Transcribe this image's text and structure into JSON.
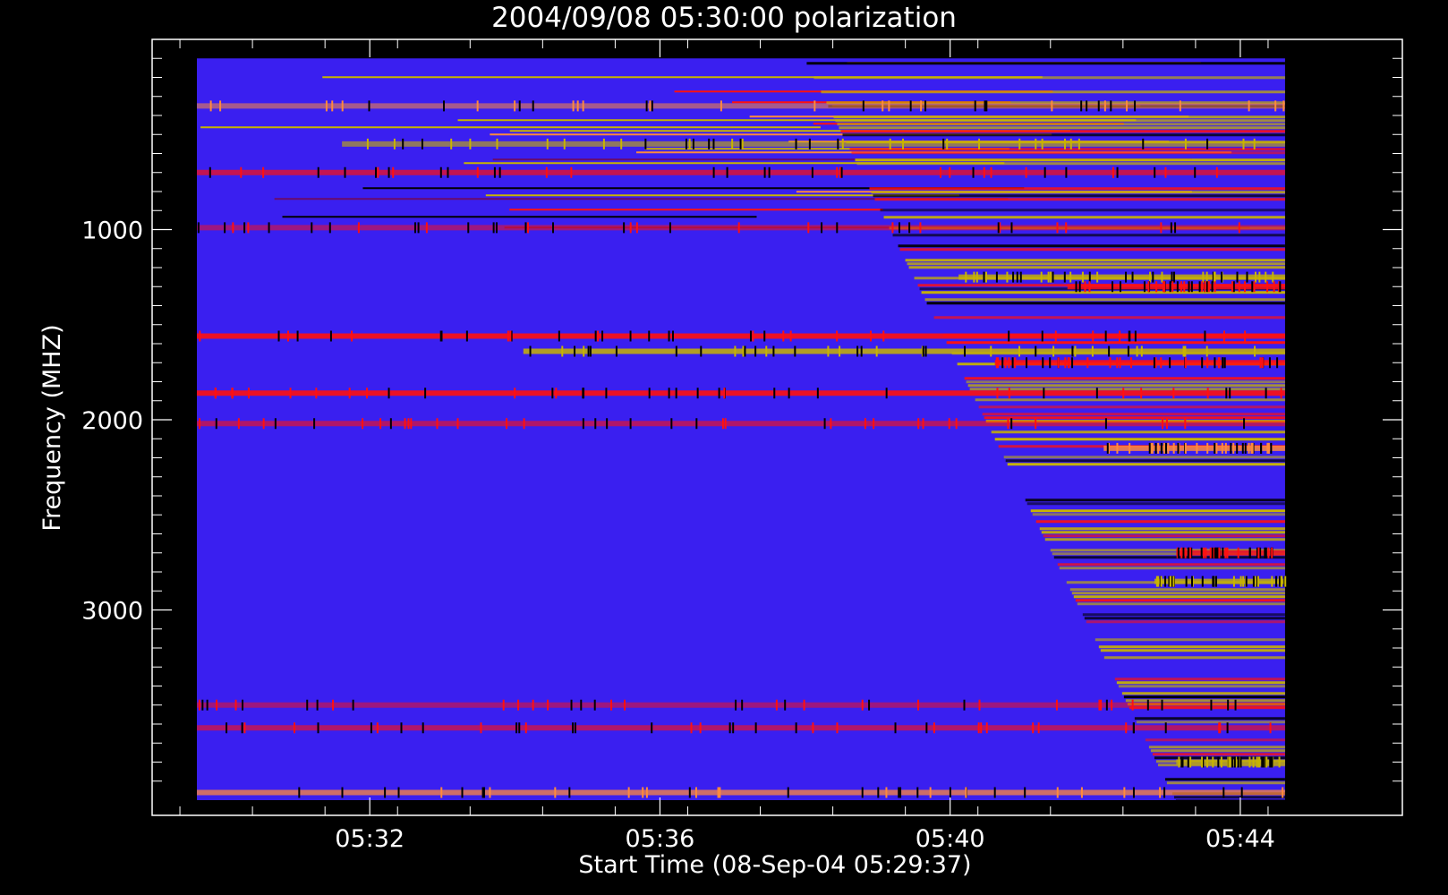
{
  "chart_data": {
    "type": "heatmap",
    "title": "2004/09/08 05:30:00 polarization",
    "xlabel": "Start Time (08-Sep-04 05:29:37)",
    "ylabel": "Frequency (MHZ)",
    "x_ticks": [
      "05:32",
      "05:36",
      "05:40",
      "05:44"
    ],
    "x_tick_minutes": [
      2.383,
      6.383,
      10.383,
      14.383
    ],
    "x_range_minutes": [
      -0.617,
      16.617
    ],
    "x_data_range_minutes": [
      0.0,
      15.0
    ],
    "y_ticks": [
      "1000",
      "2000",
      "3000"
    ],
    "y_tick_values": [
      1000,
      2000,
      3000
    ],
    "y_range": [
      0,
      4080
    ],
    "y_data_range": [
      100,
      4000
    ],
    "y_inverted": true,
    "colormap": {
      "background": "#3a1ff0",
      "levels": [
        "#000000",
        "#6a0a6a",
        "#ff1010",
        "#ff8a3c",
        "#c8b400",
        "#ffff80"
      ]
    },
    "bands": [
      {
        "freq": 350,
        "onset_min": 0,
        "strength": 0.55,
        "color": "#ff8a3c"
      },
      {
        "freq": 550,
        "onset_min": 2,
        "strength": 0.6,
        "color": "#c8b400"
      },
      {
        "freq": 700,
        "onset_min": 0,
        "strength": 0.7,
        "color": "#ff1010"
      },
      {
        "freq": 990,
        "onset_min": 0,
        "strength": 0.5,
        "color": "#ff1010"
      },
      {
        "freq": 1250,
        "onset_min": 10.5,
        "strength": 0.8,
        "color": "#c8b400"
      },
      {
        "freq": 1300,
        "onset_min": 12,
        "strength": 0.85,
        "color": "#ff1010"
      },
      {
        "freq": 1560,
        "onset_min": 0,
        "strength": 0.9,
        "color": "#ff1010"
      },
      {
        "freq": 1640,
        "onset_min": 4.5,
        "strength": 0.85,
        "color": "#c8b400"
      },
      {
        "freq": 1700,
        "onset_min": 11,
        "strength": 0.9,
        "color": "#ff1010"
      },
      {
        "freq": 1860,
        "onset_min": 0,
        "strength": 0.9,
        "color": "#ff1010"
      },
      {
        "freq": 2020,
        "onset_min": 0,
        "strength": 0.6,
        "color": "#ff1010"
      },
      {
        "freq": 2150,
        "onset_min": 12.5,
        "strength": 0.85,
        "color": "#ff8a3c"
      },
      {
        "freq": 2700,
        "onset_min": 13.5,
        "strength": 0.8,
        "color": "#ff1010"
      },
      {
        "freq": 2850,
        "onset_min": 13.2,
        "strength": 0.8,
        "color": "#c8b400"
      },
      {
        "freq": 3500,
        "onset_min": 0,
        "strength": 0.5,
        "color": "#ff1010"
      },
      {
        "freq": 3620,
        "onset_min": 0,
        "strength": 0.6,
        "color": "#ff1010"
      },
      {
        "freq": 3800,
        "onset_min": 13.5,
        "strength": 0.7,
        "color": "#c8b400"
      },
      {
        "freq": 3960,
        "onset_min": 0,
        "strength": 0.75,
        "color": "#ff8a3c"
      }
    ]
  }
}
